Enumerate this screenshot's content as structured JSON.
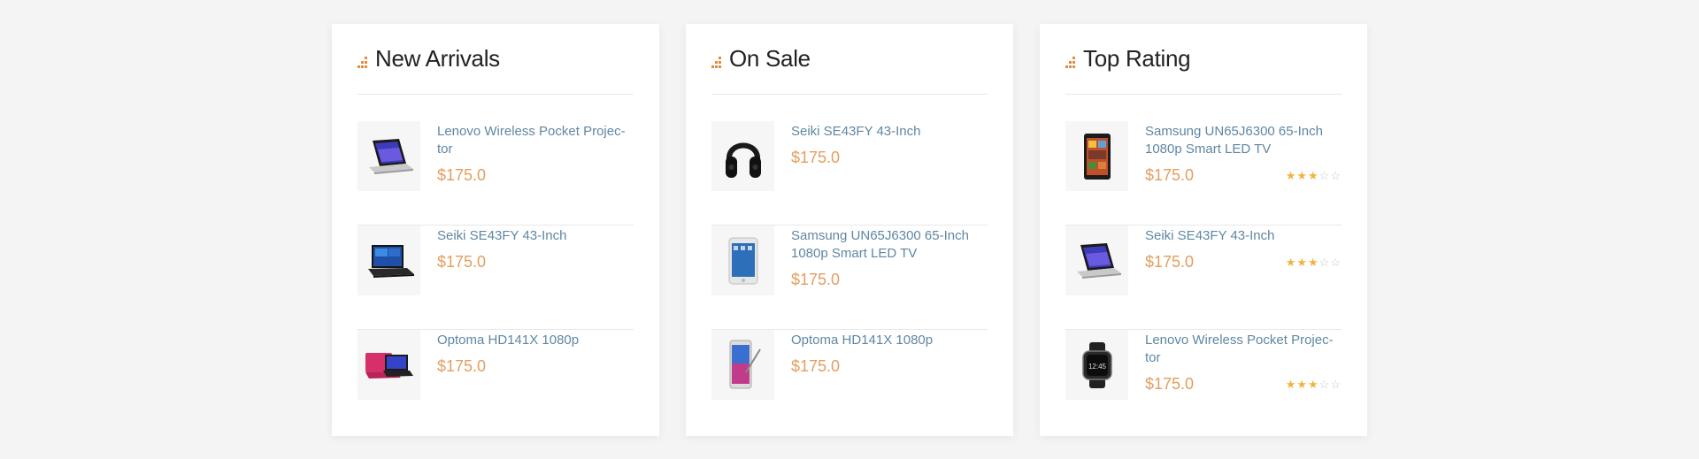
{
  "colors": {
    "accent": "#e08a3c",
    "price": "#e39e5f",
    "link": "#5f87a3",
    "star": "#f2b33d"
  },
  "cards": [
    {
      "title": "New Arrivals",
      "items": [
        {
          "name": "Lenovo Wireless Pocket Projec-\ntor",
          "price": "$175.0",
          "image": "convertible-laptop"
        },
        {
          "name": "Seiki SE43FY 43-Inch",
          "price": "$175.0",
          "image": "laptop"
        },
        {
          "name": "Optoma HD141X 1080p",
          "price": "$175.0",
          "image": "pink-laptop"
        }
      ]
    },
    {
      "title": "On Sale",
      "items": [
        {
          "name": "Seiki SE43FY 43-Inch",
          "price": "$175.0",
          "image": "headphones"
        },
        {
          "name": "Samsung UN65J6300 65-Inch\n1080p Smart LED TV",
          "price": "$175.0",
          "image": "tablet-white"
        },
        {
          "name": "Optoma HD141X 1080p",
          "price": "$175.0",
          "image": "phone-with-stylus"
        }
      ]
    },
    {
      "title": "Top Rating",
      "items": [
        {
          "name": "Samsung UN65J6300 65-Inch\n1080p Smart LED TV",
          "price": "$175.0",
          "rating": 3,
          "rating_max": 5,
          "image": "tablet-dark"
        },
        {
          "name": "Seiki SE43FY 43-Inch",
          "price": "$175.0",
          "rating": 3,
          "rating_max": 5,
          "image": "convertible-laptop"
        },
        {
          "name": "Lenovo Wireless Pocket Projec-\ntor",
          "price": "$175.0",
          "rating": 3,
          "rating_max": 5,
          "image": "smartwatch"
        }
      ]
    }
  ]
}
